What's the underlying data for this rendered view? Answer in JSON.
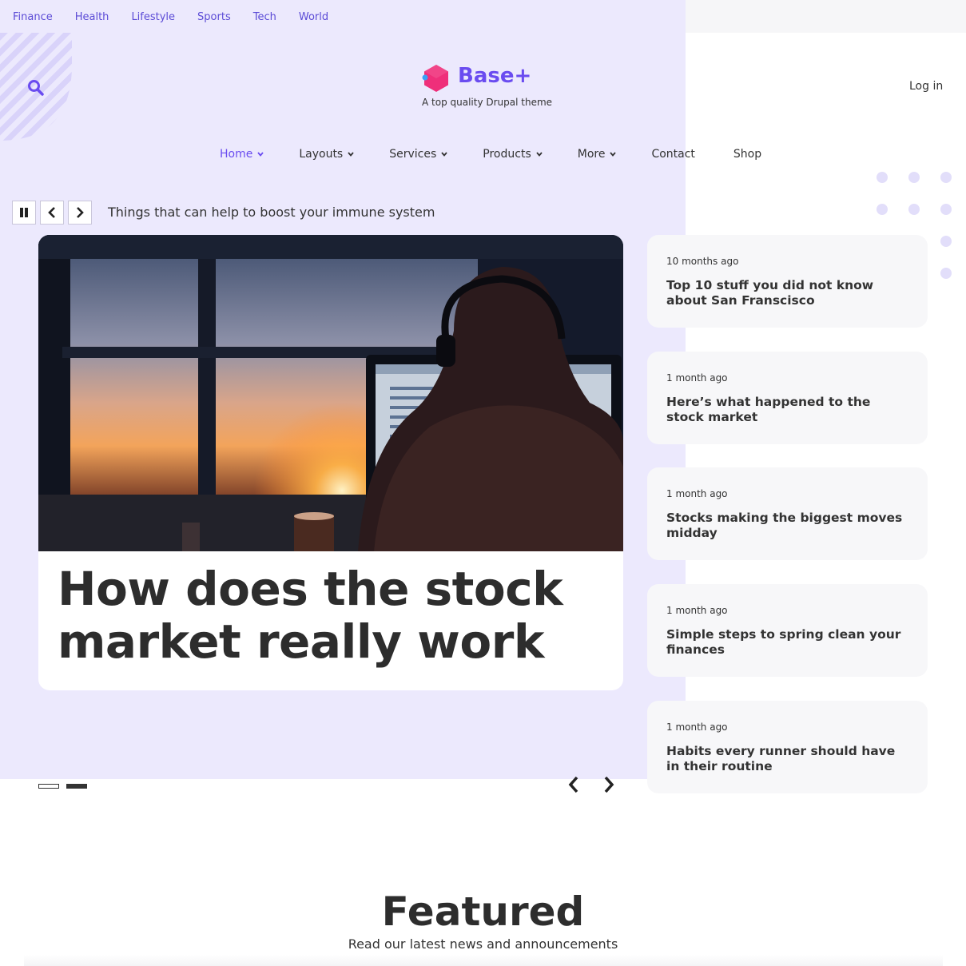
{
  "topbar": {
    "links": [
      "Finance",
      "Health",
      "Lifestyle",
      "Sports",
      "Tech",
      "World"
    ]
  },
  "brand": {
    "name": "Base+",
    "slogan": "A top quality Drupal theme",
    "accent": "#6a4cf0",
    "logo_color": "#ef2f7a"
  },
  "user": {
    "login_label": "Log in"
  },
  "mainnav": {
    "items": [
      {
        "label": "Home",
        "dropdown": true,
        "active": true
      },
      {
        "label": "Layouts",
        "dropdown": true
      },
      {
        "label": "Services",
        "dropdown": true
      },
      {
        "label": "Products",
        "dropdown": true
      },
      {
        "label": "More",
        "dropdown": true
      },
      {
        "label": "Contact",
        "dropdown": false
      },
      {
        "label": "Shop",
        "dropdown": false
      }
    ]
  },
  "ticker": {
    "text": "Things that can help to boost your immune system",
    "icons": [
      "pause-icon",
      "chevron-left-icon",
      "chevron-right-icon"
    ]
  },
  "hero": {
    "title": "How does the stock market really work",
    "image": "person with headphones at computer by window at sunset"
  },
  "sidebar": {
    "articles": [
      {
        "date": "10 months ago",
        "title": "Top 10 stuff you did not know about San Franscisco"
      },
      {
        "date": "1 month ago",
        "title": "Here’s what happened to the stock market"
      },
      {
        "date": "1 month ago",
        "title": "Stocks making the biggest moves midday"
      },
      {
        "date": "1 month ago",
        "title": "Simple steps to spring clean your finances"
      },
      {
        "date": "1 month ago",
        "title": "Habits every runner should have in their routine"
      }
    ]
  },
  "featured": {
    "title": "Featured",
    "subtitle": "Read our latest news and announcements"
  }
}
